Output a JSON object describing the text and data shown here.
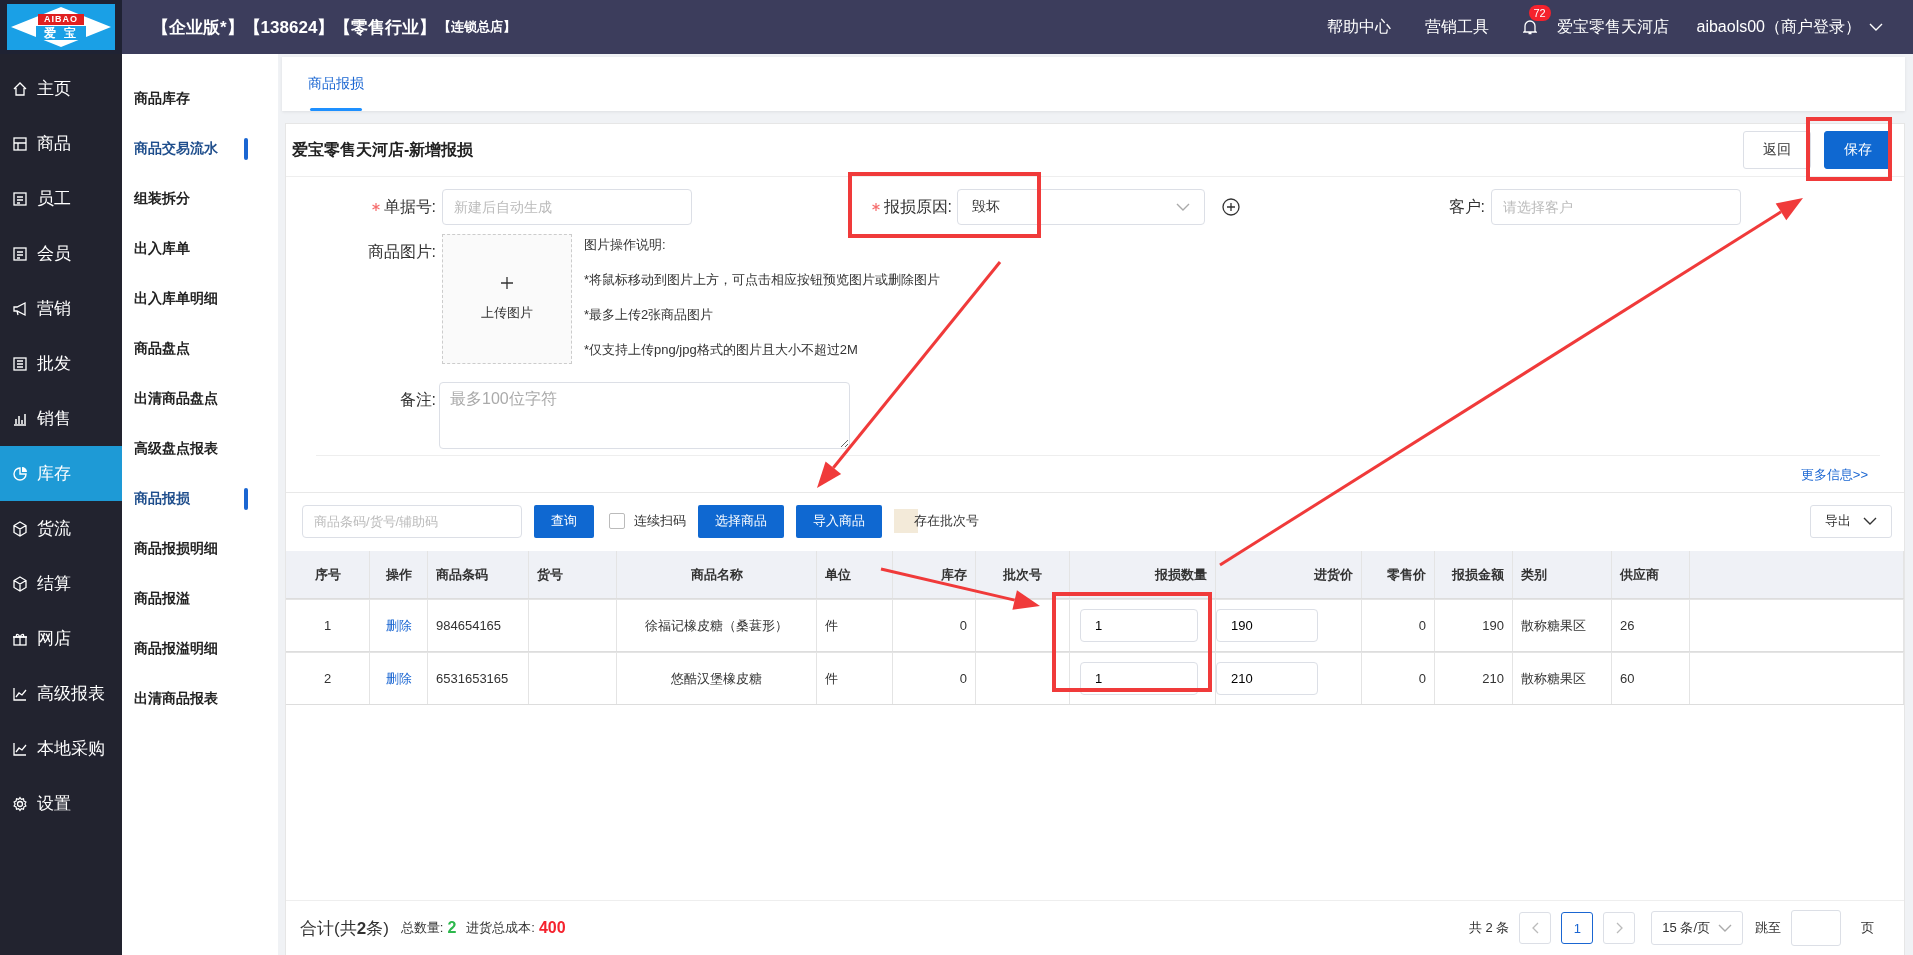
{
  "header": {
    "logo": {
      "top": "AIBAO",
      "bottom": "爱 宝"
    },
    "title": "【企业版*】【138624】【零售行业】",
    "subtitle": "【连锁总店】",
    "links": [
      "帮助中心",
      "营销工具"
    ],
    "notifications": "72",
    "store": "爱宝零售天河店",
    "user": "aibaols00（商户登录）"
  },
  "sidebar": {
    "items": [
      {
        "label": "主页",
        "selected": false
      },
      {
        "label": "商品",
        "selected": false
      },
      {
        "label": "员工",
        "selected": false
      },
      {
        "label": "会员",
        "selected": false
      },
      {
        "label": "营销",
        "selected": false
      },
      {
        "label": "批发",
        "selected": false
      },
      {
        "label": "销售",
        "selected": false
      },
      {
        "label": "库存",
        "selected": true
      },
      {
        "label": "货流",
        "selected": false
      },
      {
        "label": "结算",
        "selected": false
      },
      {
        "label": "网店",
        "selected": false
      },
      {
        "label": "高级报表",
        "selected": false
      },
      {
        "label": "本地采购",
        "selected": false
      },
      {
        "label": "设置",
        "selected": false
      }
    ]
  },
  "subnav": {
    "items": [
      {
        "label": "商品库存",
        "selected": false
      },
      {
        "label": "商品交易流水",
        "selected": true
      },
      {
        "label": "组装拆分",
        "selected": false
      },
      {
        "label": "出入库单",
        "selected": false
      },
      {
        "label": "出入库单明细",
        "selected": false
      },
      {
        "label": "商品盘点",
        "selected": false
      },
      {
        "label": "出清商品盘点",
        "selected": false
      },
      {
        "label": "高级盘点报表",
        "selected": false
      },
      {
        "label": "商品报损",
        "selected": true
      },
      {
        "label": "商品报损明细",
        "selected": false
      },
      {
        "label": "商品报溢",
        "selected": false
      },
      {
        "label": "商品报溢明细",
        "selected": false
      },
      {
        "label": "出清商品报表",
        "selected": false
      }
    ]
  },
  "tabs": [
    {
      "label": "商品报损",
      "selected": true
    }
  ],
  "form": {
    "title": "爱宝零售天河店-新增报损",
    "buttons": [
      {
        "label": "返回",
        "kind": "default"
      },
      {
        "label": "保存",
        "kind": "primary"
      }
    ],
    "doc_no": {
      "label": "单据号:",
      "required": true,
      "placeholder": "新建后自动生成"
    },
    "reason": {
      "label": "报损原因:",
      "required": true,
      "value": "毁坏"
    },
    "customer": {
      "label": "客户:",
      "required": false,
      "placeholder": "请选择客户"
    },
    "images": {
      "label": "商品图片:",
      "upload": "上传图片",
      "notes": [
        "图片操作说明:",
        "*将鼠标移动到图片上方，可点击相应按钮预览图片或删除图片",
        "*最多上传2张商品图片",
        "*仅支持上传png/jpg格式的图片且大小不超过2M"
      ]
    },
    "remark": {
      "label": "备注:",
      "placeholder": "最多100位字符"
    },
    "more_link": "更多信息>>"
  },
  "toolbar": {
    "search_placeholder": "商品条码/货号/辅助码",
    "search_button": "查询",
    "scan": {
      "label": "连续扫码",
      "checked": false
    },
    "buttons": [
      "选择商品",
      "导入商品"
    ],
    "batch_legend": "存在批次号",
    "export": "导出"
  },
  "table": {
    "columns": [
      "序号",
      "操作",
      "商品条码",
      "货号",
      "商品名称",
      "单位",
      "库存",
      "批次号",
      "报损数量",
      "进货价",
      "零售价",
      "报损金额",
      "类别",
      "供应商"
    ],
    "rows": [
      {
        "index": "1",
        "action": "删除",
        "barcode": "984654165",
        "name": "徐福记橡皮糖（桑葚形）",
        "unit": "件",
        "stock": "0",
        "quantity": "1",
        "cost": "190",
        "retail": "0",
        "amount": "190",
        "category": "散称糖果区",
        "supplier": "26"
      },
      {
        "index": "2",
        "action": "删除",
        "barcode": "6531653165",
        "name": "悠酷汉堡橡皮糖",
        "unit": "件",
        "stock": "0",
        "quantity": "1",
        "cost": "210",
        "retail": "0",
        "amount": "210",
        "category": "散称糖果区",
        "supplier": "60"
      }
    ]
  },
  "footer": {
    "summary": "合计(共**2**条)",
    "qty_label": "总数量:",
    "qty": "2",
    "cost_label": "进货总成本:",
    "cost": "400",
    "total": "共 2 条",
    "pages": [
      {
        "label": "1",
        "selected": true
      }
    ],
    "page_size": "15 条/页",
    "jump_label": "跳至",
    "page_unit": "页"
  }
}
